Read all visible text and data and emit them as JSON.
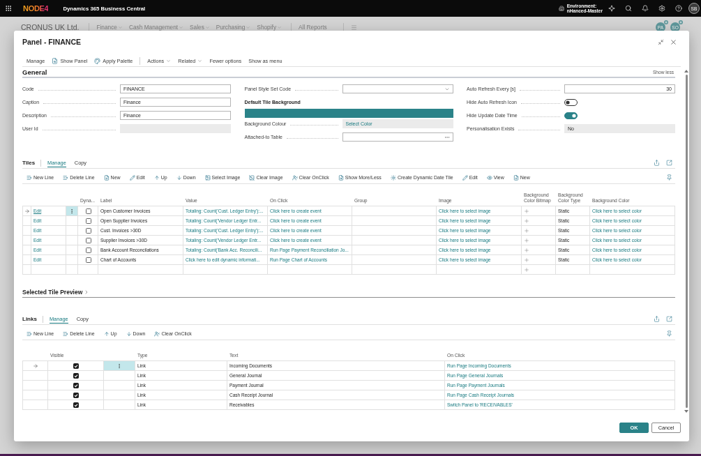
{
  "app_bar": {
    "logo": "NODE4",
    "product": "Dynamics 365 Business Central",
    "environment_label": "Environment:",
    "environment": "nHanced-Master",
    "user_initials": "SB"
  },
  "nav": {
    "company": "CRONUS UK Ltd.",
    "menus": [
      "Finance",
      "Cash Management",
      "Sales",
      "Purchasing",
      "Shopify"
    ],
    "links": [
      "All Reports"
    ],
    "avatars": [
      "PA",
      "SO"
    ]
  },
  "dialog": {
    "title": "Panel - FINANCE",
    "action_groups": [
      [
        {
          "label": "Manage",
          "kind": "plain"
        },
        {
          "label": "Show Panel",
          "kind": "icon"
        },
        {
          "label": "Apply Palette",
          "kind": "icon"
        }
      ],
      [
        {
          "label": "Actions",
          "kind": "menu"
        },
        {
          "label": "Related",
          "kind": "menu"
        },
        {
          "label": "Fewer options",
          "kind": "plain"
        },
        {
          "label": "Show as menu",
          "kind": "plain"
        }
      ]
    ],
    "general": {
      "title": "General",
      "toggle_label": "Show less",
      "columns": [
        [
          {
            "label": "Code",
            "kind": "text",
            "value": "FINANCE"
          },
          {
            "label": "Caption",
            "kind": "text",
            "value": "Finance"
          },
          {
            "label": "Description",
            "kind": "text",
            "value": "Finance"
          },
          {
            "label": "User Id",
            "kind": "readonly"
          }
        ],
        [
          {
            "label": "Panel Style Set Code",
            "kind": "dropdown"
          },
          {
            "label": "Default Tile Background",
            "kind": "heading"
          },
          {
            "kind": "color_bar",
            "color": "#2b8389"
          },
          {
            "label": "Background Colour",
            "kind": "color_picker",
            "value": "Select Color"
          },
          {
            "label": "Attached-to Table",
            "kind": "lookup"
          }
        ],
        [
          {
            "label": "Auto Refresh Every [s]",
            "kind": "number",
            "value": "30"
          },
          {
            "label": "Hide Auto Refresh Icon",
            "kind": "toggle",
            "on": false
          },
          {
            "label": "Hide Update Date Time",
            "kind": "toggle",
            "on": true
          },
          {
            "label": "Personalisation Exists",
            "kind": "readonly",
            "value": "No"
          }
        ]
      ]
    },
    "tiles": {
      "title": "Tiles",
      "tabs": [
        {
          "label": "Manage",
          "selected": true
        },
        {
          "label": "Copy",
          "selected": false
        }
      ],
      "toolbar": [
        "New Line",
        "Delete Line",
        "New",
        "Edit",
        "Up",
        "Down",
        "Select Image",
        "Clear Image",
        "Clear OnClick",
        "Show More/Less",
        "Create Dynamic Date Tile",
        "Edit",
        "View",
        "New"
      ],
      "columns": [
        "Dyna...",
        "Label",
        "Value",
        "On Click",
        "Group",
        "Image",
        "Background Color Bitmap",
        "Background Color Type",
        "Background Color"
      ],
      "rows": [
        {
          "selected": true,
          "action": "Edit",
          "dynamic": false,
          "label": "Open Customer Invoices",
          "value": "Totaling: Count('Cust. Ledger Entry'):...",
          "on_click": "Click here to create event",
          "image": "Click here to select image",
          "color_type": "Static",
          "background_color": "Click here to select color"
        },
        {
          "selected": false,
          "action": "Edit",
          "dynamic": false,
          "label": "Open Supplier Invoices",
          "value": "Totaling: Count('Vendor Ledger Entr...",
          "on_click": "Click here to create event",
          "image": "Click here to select image",
          "color_type": "Static",
          "background_color": "Click here to select color"
        },
        {
          "selected": false,
          "action": "Edit",
          "dynamic": false,
          "label": "Cust. Invoices >30D",
          "value": "Totaling: Count('Cust. Ledger Entry'):...",
          "on_click": "Click here to create event",
          "image": "Click here to select image",
          "color_type": "Static",
          "background_color": "Click here to select color"
        },
        {
          "selected": false,
          "action": "Edit",
          "dynamic": false,
          "label": "Supplier Invoices >30D",
          "value": "Totaling: Count('Vendor Ledger Entr...",
          "on_click": "Click here to create event",
          "image": "Click here to select image",
          "color_type": "Static",
          "background_color": "Click here to select color"
        },
        {
          "selected": false,
          "action": "Edit",
          "dynamic": false,
          "label": "Bank Account Reconcilations",
          "value": "Totaling: Count('Bank Acc. Reconcili...",
          "on_click": "Run Page Payment Reconciliation Jo...",
          "image": "Click here to select image",
          "color_type": "Static",
          "background_color": "Click here to select color"
        },
        {
          "selected": false,
          "action": "Edit",
          "dynamic": false,
          "label": "Chart of Accounts",
          "value": "Click here to edit dynamic informati...",
          "on_click": "Run Page Chart of Accounts",
          "image": "Click here to select image",
          "color_type": "Static",
          "background_color": "Click here to select color"
        }
      ]
    },
    "preview_heading": "Selected Tile Preview",
    "links": {
      "title": "Links",
      "tabs": [
        {
          "label": "Manage",
          "selected": true
        },
        {
          "label": "Copy",
          "selected": false
        }
      ],
      "toolbar": [
        "New Line",
        "Delete Line",
        "Up",
        "Down",
        "Clear OnClick"
      ],
      "columns": [
        "Visible",
        "Type",
        "Text",
        "On Click"
      ],
      "rows": [
        {
          "selected": true,
          "visible": true,
          "type": "Link",
          "text": "Incoming Documents",
          "on_click": "Run Page Incoming Documents"
        },
        {
          "selected": false,
          "visible": true,
          "type": "Link",
          "text": "General Journal",
          "on_click": "Run Page General Journals"
        },
        {
          "selected": false,
          "visible": true,
          "type": "Link",
          "text": "Payment Journal",
          "on_click": "Run Page Payment Journals"
        },
        {
          "selected": false,
          "visible": true,
          "type": "Link",
          "text": "Cash Receipt Journal",
          "on_click": "Run Page Cash Receipt Journals"
        },
        {
          "selected": false,
          "visible": true,
          "type": "Link",
          "text": "Receivables",
          "on_click": "Switch Panel to 'RECEIVABLES'"
        }
      ]
    },
    "buttons": [
      {
        "label": "OK",
        "kind": "primary"
      },
      {
        "label": "Cancel",
        "kind": "secondary"
      }
    ]
  }
}
